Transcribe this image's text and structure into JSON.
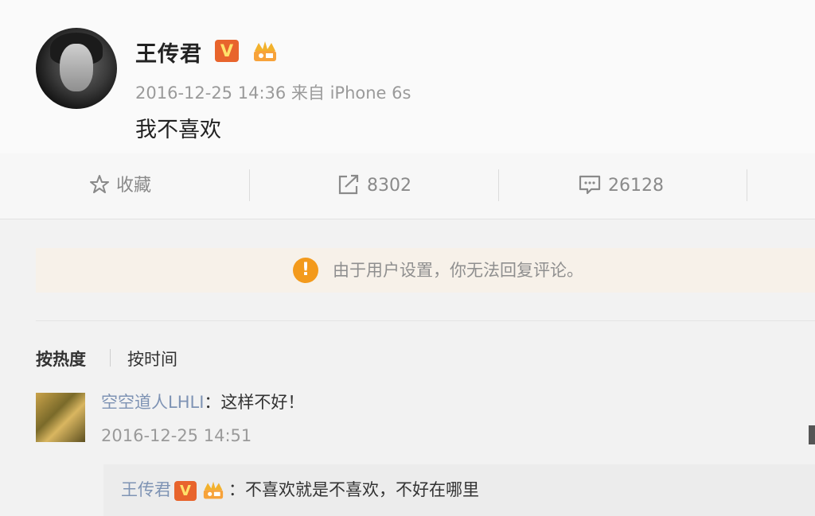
{
  "post": {
    "author": "王传君",
    "verified_badge": "V",
    "vip_icon": "vip-crown-icon",
    "meta": "2016-12-25 14:36 来自 iPhone 6s",
    "content": "我不喜欢"
  },
  "actions": {
    "favorite": {
      "icon": "star-icon",
      "label": "收藏"
    },
    "repost": {
      "icon": "share-icon",
      "label": "8302"
    },
    "comment": {
      "icon": "comment-icon",
      "label": "26128"
    }
  },
  "notice": {
    "icon": "warning-icon",
    "symbol": "!",
    "text": "由于用户设置，你无法回复评论。"
  },
  "sort": {
    "hot": "按热度",
    "time": "按时间"
  },
  "comment": {
    "user": "空空道人LHLI",
    "text": "：这样不好！",
    "time": "2016-12-25 14:51"
  },
  "reply": {
    "user": "王传君",
    "verified_badge": "V",
    "text": "：不喜欢就是不喜欢，不好在哪里"
  },
  "colors": {
    "accent_orange": "#f39a1c",
    "verified": "#e8642c",
    "link_blue": "#7e93b4"
  }
}
